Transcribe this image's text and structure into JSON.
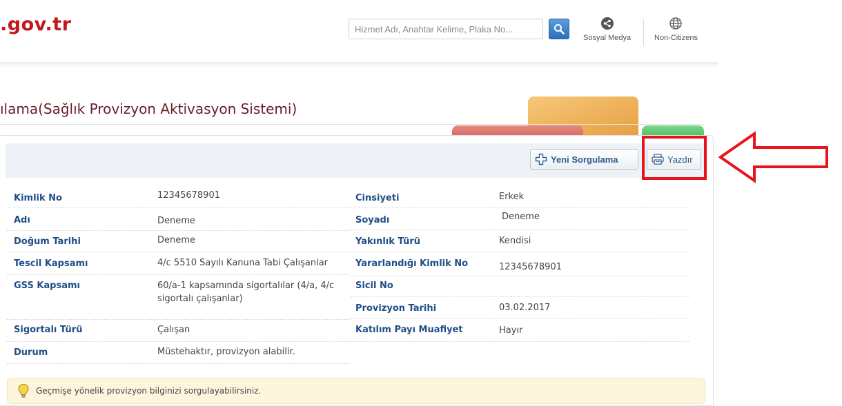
{
  "header": {
    "logo": ".gov.tr",
    "search_placeholder": "Hizmet Adı, Anahtar Kelime, Plaka No...",
    "social_label": "Sosyal Medya",
    "citizens_label": "Non-Citizens"
  },
  "page": {
    "title": "ılama(Sağlık Provizyon Aktivasyon Sistemi)"
  },
  "toolbar": {
    "new_query_label": "Yeni Sorgulama",
    "print_label": "Yazdır"
  },
  "left_fields": [
    {
      "label": "Kimlik No",
      "value": "12345678901"
    },
    {
      "label": "Adı",
      "value": "Deneme"
    },
    {
      "label": "Doğum Tarihi",
      "value": "Deneme"
    },
    {
      "label": "Tescil Kapsamı",
      "value": "4/c 5510 Sayılı Kanuna Tabi Çalışanlar"
    },
    {
      "label": "GSS Kapsamı",
      "value": "60/a-1 kapsamında sigortalılar (4/a, 4/c sigortalı çalışanlar)"
    },
    {
      "label": "Sigortalı Türü",
      "value": "Çalışan"
    },
    {
      "label": "Durum",
      "value": "Müstehaktır, provizyon alabilir."
    }
  ],
  "right_fields": [
    {
      "label": "Cinsiyeti",
      "value": "Erkek"
    },
    {
      "label": "Soyadı",
      "value": "Deneme"
    },
    {
      "label": "Yakınlık Türü",
      "value": "Kendisi"
    },
    {
      "label": "Yararlandığı Kimlik No",
      "value": "12345678901"
    },
    {
      "label": "Sicil No",
      "value": ""
    },
    {
      "label": "Provizyon Tarihi",
      "value": "03.02.2017"
    },
    {
      "label": "Katılım Payı Muafiyet",
      "value": "Hayır"
    }
  ],
  "info": {
    "text": "Geçmişe yönelik provizyon bilginizi sorgulayabilirsiniz."
  },
  "colors": {
    "logo": "#c4161c",
    "label": "#1f4e86",
    "title": "#6a1e2a",
    "highlight": "#e8141b"
  }
}
